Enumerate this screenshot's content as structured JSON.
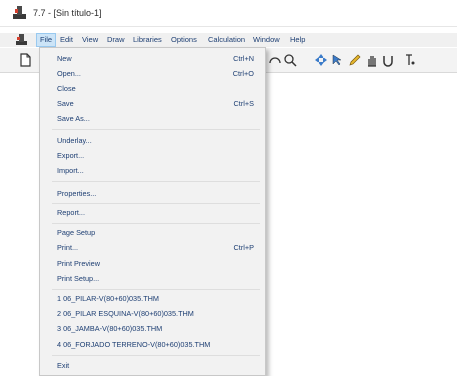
{
  "window": {
    "title": "7.7 - [Sin título-1]"
  },
  "menubar": {
    "items": [
      {
        "label": "File"
      },
      {
        "label": "Edit"
      },
      {
        "label": "View"
      },
      {
        "label": "Draw"
      },
      {
        "label": "Libraries"
      },
      {
        "label": "Options"
      },
      {
        "label": "Calculation"
      },
      {
        "label": "Window"
      },
      {
        "label": "Help"
      }
    ]
  },
  "file_menu": {
    "items": [
      {
        "label": "New",
        "shortcut": "Ctrl+N"
      },
      {
        "label": "Open...",
        "shortcut": "Ctrl+O"
      },
      {
        "label": "Close",
        "shortcut": ""
      },
      {
        "label": "Save",
        "shortcut": "Ctrl+S"
      },
      {
        "label": "Save As...",
        "shortcut": ""
      },
      {
        "label": "Underlay...",
        "shortcut": ""
      },
      {
        "label": "Export...",
        "shortcut": ""
      },
      {
        "label": "Import...",
        "shortcut": ""
      },
      {
        "label": "Properties...",
        "shortcut": ""
      },
      {
        "label": "Report...",
        "shortcut": ""
      },
      {
        "label": "Page Setup",
        "shortcut": ""
      },
      {
        "label": "Print...",
        "shortcut": "Ctrl+P"
      },
      {
        "label": "Print Preview",
        "shortcut": ""
      },
      {
        "label": "Print Setup...",
        "shortcut": ""
      },
      {
        "label": "1 06_PILAR-V(80+60)035.THM",
        "shortcut": ""
      },
      {
        "label": "2 06_PILAR ESQUINA-V(80+60)035.THM",
        "shortcut": ""
      },
      {
        "label": "3 06_JAMBA-V(80+60)035.THM",
        "shortcut": ""
      },
      {
        "label": "4 06_FORJADO TERRENO-V(80+60)035.THM",
        "shortcut": ""
      },
      {
        "label": "Exit",
        "shortcut": ""
      }
    ]
  },
  "colors": {
    "menu_text": "#1e3f73",
    "menu_background": "#f2f2f2",
    "active_menu_highlight": "#cce4f7"
  },
  "toolbar": {
    "icons": [
      "new-document-icon",
      "arc-icon",
      "zoom-icon",
      "pan-icon",
      "select-node-icon",
      "pencil-icon",
      "hand-icon",
      "u-value-icon",
      "temperature-icon"
    ]
  }
}
